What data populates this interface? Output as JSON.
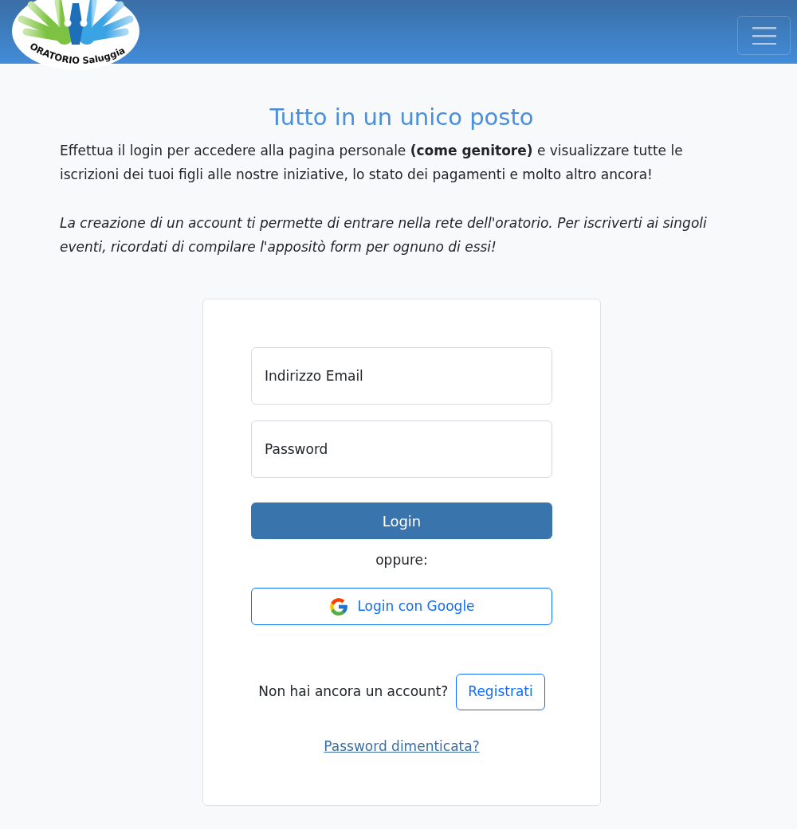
{
  "header": {
    "logo_text": "ORATORIO Saluggia"
  },
  "intro": {
    "title": "Tutto in un unico posto",
    "paragraphs": [
      {
        "text": "Effettua il login per accedere alla pagina personale **(come genitore)** e visualizzare tutte le iscrizioni dei tuoi figli alle nostre iniziative, lo stato dei pagamenti e molto altro ancora!",
        "italic": false
      },
      {
        "text": "La creazione di un account ti permette di entrare nella rete dell'oratorio. Per iscriverti ai singoli eventi, ricordati di compilare l'appositò form per ognuno di essi!",
        "italic": true
      }
    ]
  },
  "login_form": {
    "fields": [
      {
        "placeholder": "Indirizzo Email"
      },
      {
        "placeholder": "Password"
      }
    ],
    "submit": "Login",
    "separator": "oppure:",
    "google_button": "Login con Google",
    "register_prompt": "Non hai ancora un account?",
    "register_button": "Registrati",
    "forgot_link": "Password dimenticata?"
  }
}
